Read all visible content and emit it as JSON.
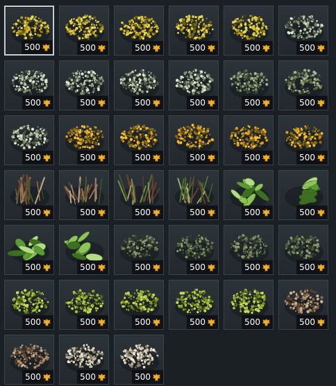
{
  "currency_icon": "golden-eagles-icon",
  "colors": {
    "background": "#1b2024",
    "cell": "#262d32",
    "price_text": "#ffffff",
    "gold": "#f2b01e"
  },
  "items": [
    {
      "price": "500",
      "icon": "yellow-shrub-icon",
      "selected": true
    },
    {
      "price": "500",
      "icon": "yellow-shrub-icon"
    },
    {
      "price": "500",
      "icon": "yellow-shrub-icon"
    },
    {
      "price": "500",
      "icon": "yellow-shrub-icon"
    },
    {
      "price": "500",
      "icon": "yellow-shrub-icon"
    },
    {
      "price": "500",
      "icon": "pale-green-shrub-icon"
    },
    {
      "price": "500",
      "icon": "pale-green-shrub-icon"
    },
    {
      "price": "500",
      "icon": "pale-green-shrub-icon"
    },
    {
      "price": "500",
      "icon": "pale-green-shrub-icon"
    },
    {
      "price": "500",
      "icon": "pale-green-shrub-icon"
    },
    {
      "price": "500",
      "icon": "green-grass-icon"
    },
    {
      "price": "500",
      "icon": "green-grass-icon"
    },
    {
      "price": "500",
      "icon": "pale-green-shrub-icon"
    },
    {
      "price": "500",
      "icon": "orange-flower-bush-icon"
    },
    {
      "price": "500",
      "icon": "orange-flower-bush-icon"
    },
    {
      "price": "500",
      "icon": "orange-flower-bush-icon"
    },
    {
      "price": "500",
      "icon": "orange-flower-bush-icon"
    },
    {
      "price": "500",
      "icon": "orange-flower-bush-icon"
    },
    {
      "price": "500",
      "icon": "brown-sticks-icon"
    },
    {
      "price": "500",
      "icon": "brown-sticks-icon"
    },
    {
      "price": "500",
      "icon": "fern-icon"
    },
    {
      "price": "500",
      "icon": "fern-icon"
    },
    {
      "price": "500",
      "icon": "banana-leaf-icon"
    },
    {
      "price": "500",
      "icon": "banana-leaf-icon"
    },
    {
      "price": "500",
      "icon": "banana-leaf-icon"
    },
    {
      "price": "500",
      "icon": "banana-leaf-icon"
    },
    {
      "price": "500",
      "icon": "dark-green-shrub-icon"
    },
    {
      "price": "500",
      "icon": "dark-green-shrub-icon"
    },
    {
      "price": "500",
      "icon": "dark-green-shrub-icon"
    },
    {
      "price": "500",
      "icon": "dark-green-shrub-icon"
    },
    {
      "price": "500",
      "icon": "light-green-bush-icon"
    },
    {
      "price": "500",
      "icon": "light-green-bush-icon"
    },
    {
      "price": "500",
      "icon": "light-green-bush-icon"
    },
    {
      "price": "500",
      "icon": "light-green-bush-icon"
    },
    {
      "price": "500",
      "icon": "light-green-bush-icon"
    },
    {
      "price": "500",
      "icon": "dry-brown-bush-icon"
    },
    {
      "price": "500",
      "icon": "dry-brown-bush-icon"
    },
    {
      "price": "500",
      "icon": "dry-straw-grass-icon"
    },
    {
      "price": "500",
      "icon": "dry-straw-grass-icon"
    }
  ]
}
